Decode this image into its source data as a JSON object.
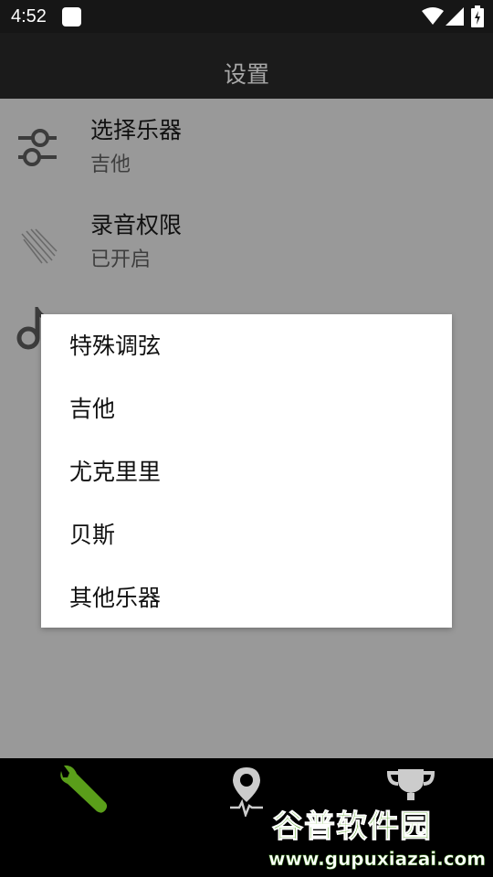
{
  "status_bar": {
    "time": "4:52",
    "icons": [
      "notification-icon",
      "wifi-icon",
      "signal-icon",
      "battery-charging-icon"
    ]
  },
  "app_bar": {
    "title": "设置"
  },
  "settings": [
    {
      "title": "选择乐器",
      "subtitle": "吉他",
      "icon": "sliders-icon"
    },
    {
      "title": "录音权限",
      "subtitle": "已开启",
      "icon": "record-permission-icon"
    },
    {
      "icon": "music-note-icon"
    }
  ],
  "dialog": {
    "options": [
      "特殊调弦",
      "吉他",
      "尤克里里",
      "贝斯",
      "其他乐器"
    ]
  },
  "bottom_nav": {
    "items": [
      {
        "icon": "wrench-icon",
        "active": true
      },
      {
        "icon": "location-pulse-icon",
        "active": false
      },
      {
        "icon": "trophy-icon",
        "active": false
      }
    ],
    "active_color": "#5a9e1a",
    "inactive_color": "#cccccc"
  },
  "watermark": {
    "line1": "谷普软件园",
    "line2": "www.gupuxiazai.com"
  }
}
